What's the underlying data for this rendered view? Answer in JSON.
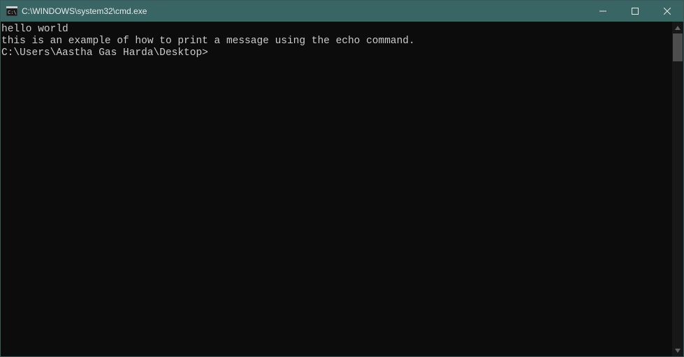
{
  "titlebar": {
    "title": "C:\\WINDOWS\\system32\\cmd.exe"
  },
  "terminal": {
    "lines": {
      "0": "hello world",
      "1": "this is an example of how to print a message using the echo command.",
      "2": "C:\\Users\\Aastha Gas Harda\\Desktop>"
    }
  }
}
